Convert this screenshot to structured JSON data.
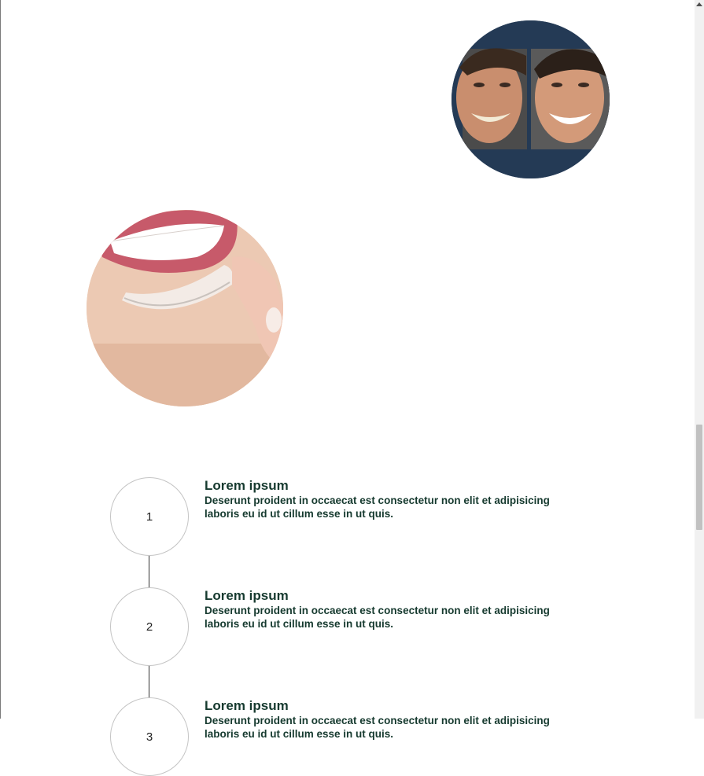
{
  "images": {
    "before_after": {
      "icon": "before-after-smile-photo"
    },
    "aligner": {
      "icon": "clear-aligner-photo"
    }
  },
  "steps": [
    {
      "number": "1",
      "title": "Lorem ipsum",
      "text": "Deserunt proident in occaecat est consectetur non elit et adipisicing laboris eu id ut cillum esse in ut quis."
    },
    {
      "number": "2",
      "title": "Lorem ipsum",
      "text": "Deserunt proident in occaecat est consectetur non elit et adipisicing laboris eu id ut cillum esse in ut quis."
    },
    {
      "number": "3",
      "title": "Lorem ipsum",
      "text": "Deserunt proident in occaecat est consectetur non elit et adipisicing laboris eu id ut cillum esse in ut quis."
    }
  ],
  "colors": {
    "heading": "#163a2f",
    "photo_backdrop": "#243a55"
  }
}
